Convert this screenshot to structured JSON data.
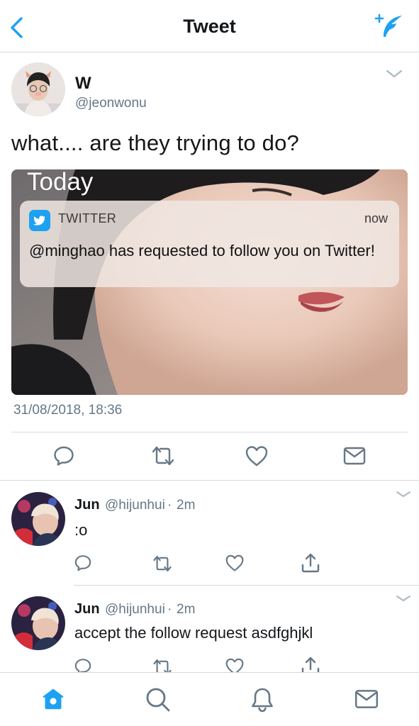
{
  "navbar": {
    "title": "Tweet",
    "back_icon": "chevron-left-icon",
    "compose_icon": "compose-feather-icon"
  },
  "tweet": {
    "author_name": "W",
    "author_handle": "@jeonwonu",
    "text": "what.... are they trying to do?",
    "timestamp": "31/08/2018, 18:36",
    "media": {
      "today_label": "Today",
      "notification": {
        "app_name": "TWITTER",
        "time": "now",
        "message": "@minghao has requested to follow you on Twitter!"
      }
    },
    "actions": [
      "reply-icon",
      "retweet-icon",
      "like-icon",
      "message-icon"
    ]
  },
  "replies": [
    {
      "name": "Jun",
      "handle": "@hijunhui",
      "dot": "·",
      "time": "2m",
      "text": ":o"
    },
    {
      "name": "Jun",
      "handle": "@hijunhui",
      "dot": "·",
      "time": "2m",
      "text": "accept the follow request asdfghjkl"
    }
  ],
  "tabbar": [
    "home-icon",
    "search-icon",
    "notifications-icon",
    "messages-icon"
  ],
  "colors": {
    "accent": "#1da1f2",
    "text_primary": "#14171a",
    "text_secondary": "#657786",
    "icon_gray": "#657786",
    "divider": "#d6dadf"
  }
}
